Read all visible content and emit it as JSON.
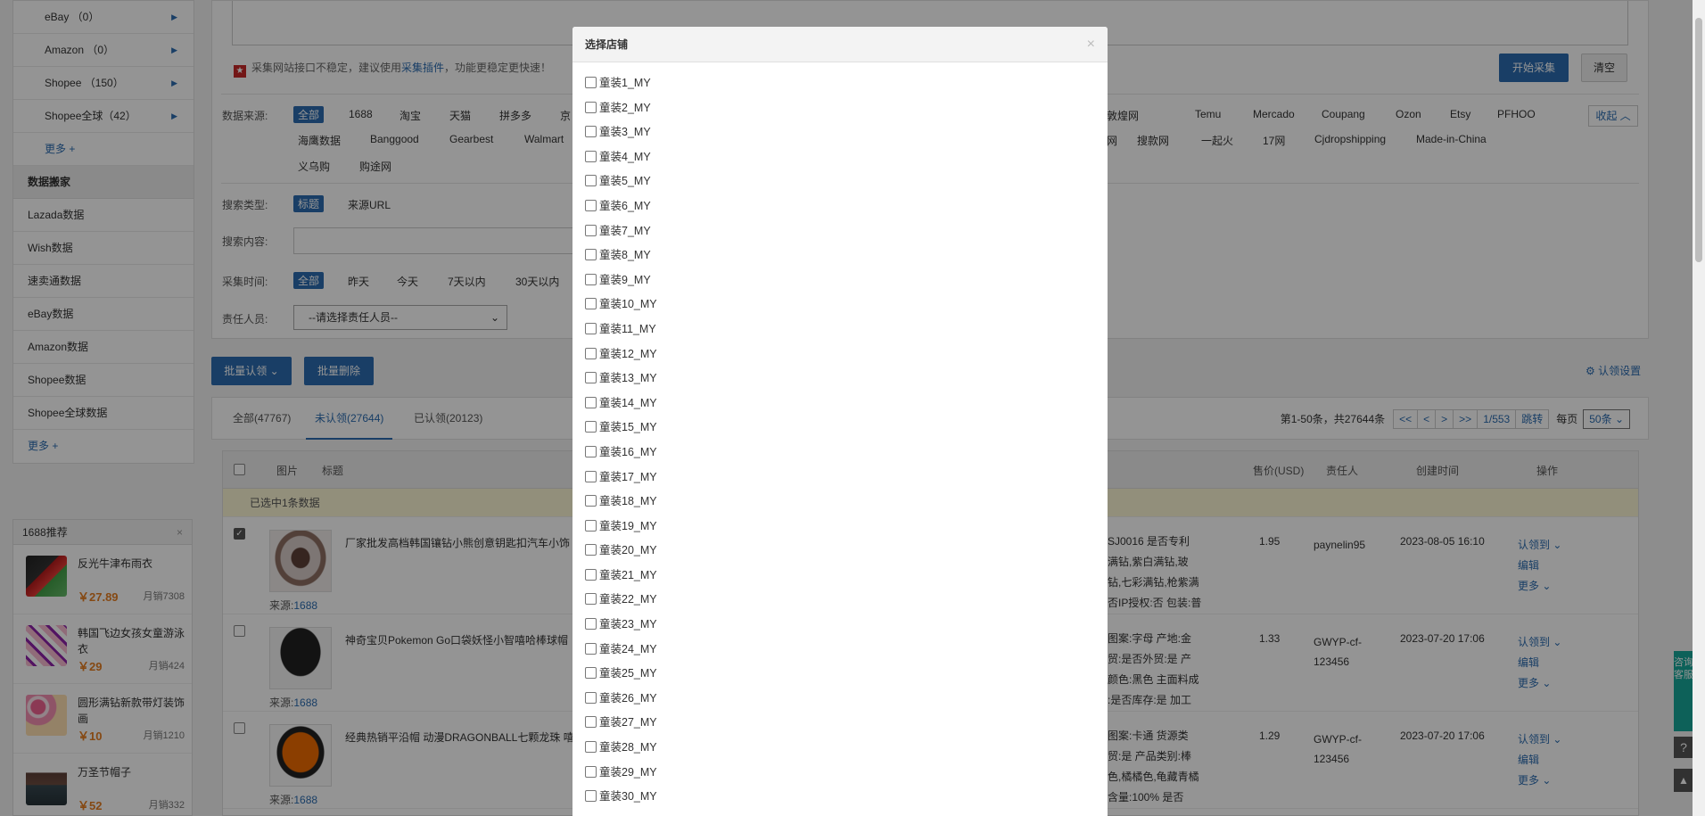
{
  "sidebar": {
    "platforms": [
      {
        "label": "eBay （0）"
      },
      {
        "label": "Amazon （0）"
      },
      {
        "label": "Shopee （150）"
      },
      {
        "label": "Shopee全球（42）"
      }
    ],
    "more1": "更多 +",
    "section_title": "数据搬家",
    "links": [
      "Lazada数据",
      "Wish数据",
      "速卖通数据",
      "eBay数据",
      "Amazon数据",
      "Shopee数据",
      "Shopee全球数据"
    ],
    "more2": "更多 +"
  },
  "recommend": {
    "title": "1688推荐",
    "close": "×",
    "items": [
      {
        "title": "反光牛津布雨衣",
        "price": "￥27.89",
        "sales": "月销7308"
      },
      {
        "title": "韩国飞边女孩女童游泳衣",
        "price": "￥29",
        "sales": "月销424"
      },
      {
        "title": "圆形满钻新款带灯装饰画",
        "price": "￥10",
        "sales": "月销1210"
      },
      {
        "title": "万圣节帽子",
        "price": "￥52",
        "sales": "月销332"
      }
    ]
  },
  "collect": {
    "warning_pre": "采集网站接口不稳定，建议使用",
    "warning_link": "采集插件",
    "warning_post": "，功能更稳定更快速！",
    "start_button": "开始采集",
    "clear_button": "清空"
  },
  "filters": {
    "source_label": "数据来源:",
    "source_all": "全部",
    "sources_row1_left": [
      "1688",
      "淘宝",
      "天猫",
      "拼多多",
      "京"
    ],
    "sources_row1_right": [
      "敦煌网",
      "Temu",
      "Mercado",
      "Coupang",
      "Ozon",
      "Etsy",
      "PFHOO"
    ],
    "sources_row2_left": [
      "海鹰数据",
      "Banggood",
      "Gearbest",
      "Walmart"
    ],
    "sources_row2_right": [
      "网",
      "搜款网",
      "一起火",
      "17网",
      "Cjdropshipping",
      "Made-in-China"
    ],
    "sources_row3": [
      "义乌购",
      "购途网"
    ],
    "collapse": "收起",
    "search_type_label": "搜索类型:",
    "search_type_active": "标题",
    "search_type_other": "来源URL",
    "search_content_label": "搜索内容:",
    "time_label": "采集时间:",
    "time_all": "全部",
    "time_options": [
      "昨天",
      "今天",
      "7天以内",
      "30天以内"
    ],
    "owner_label": "责任人员:",
    "owner_select": "--请选择责任人员--"
  },
  "actions": {
    "batch_claim": "批量认领",
    "batch_delete": "批量删除",
    "claim_settings": "认领设置"
  },
  "tabs": [
    {
      "label": "全部(47767)"
    },
    {
      "label": "未认领(27644)"
    },
    {
      "label": "已认领(20123)"
    }
  ],
  "pager": {
    "info": "第1-50条，共27644条",
    "first": "<<",
    "prev": "<",
    "next": ">",
    "last": ">>",
    "page": "1/553",
    "jump": "跳转",
    "per_page_label": "每页",
    "per_page": "50条"
  },
  "table": {
    "headers": {
      "image": "图片",
      "title": "标题",
      "price": "售价(USD)",
      "owner": "责任人",
      "created": "创建时间",
      "ops": "操作"
    },
    "selected_info": "已选中1条数据",
    "rows": [
      {
        "title": "厂家批发高档韩国镶钻小熊创意钥匙扣汽车小饰",
        "source_label": "来源:",
        "source": "1688",
        "specs": [
          "SJ0016 是否专利",
          "满钻,紫白满钻,玻",
          "钻,七彩满钻,枪紫满",
          "否IP授权:否 包装:普"
        ],
        "price": "1.95",
        "owner": "paynelin95",
        "created": "2023-08-05 16:10",
        "ops": [
          "认领到",
          "编辑",
          "更多"
        ]
      },
      {
        "title": "神奇宝贝Pokemon Go口袋妖怪小智嘻哈棒球帽",
        "source_label": "来源:",
        "source": "1688",
        "specs": [
          "图案:字母 产地:金",
          "贸:是否外贸:是 产",
          "颜色:黑色 主面料成",
          ":是否库存:是 加工"
        ],
        "price": "1.33",
        "owner": "GWYP-cf-123456",
        "created": "2023-07-20 17:06",
        "ops": [
          "认领到",
          "编辑",
          "更多"
        ]
      },
      {
        "title": "经典热销平沿帽 动漫DRAGONBALL七颗龙珠 嘻",
        "source_label": "来源:",
        "source": "1688",
        "specs": [
          "图案:卡通 货源类",
          "贸:是 产品类别:棒",
          "色,橘橘色,龟藏青橘",
          "含量:100% 是否"
        ],
        "price": "1.29",
        "owner": "GWYP-cf-123456",
        "created": "2023-07-20 17:06",
        "ops": [
          "认领到",
          "编辑",
          "更多"
        ]
      }
    ]
  },
  "modal": {
    "title": "选择店铺",
    "close": "×",
    "shops": [
      "童装1_MY",
      "童装2_MY",
      "童装3_MY",
      "童装4_MY",
      "童装5_MY",
      "童装6_MY",
      "童装7_MY",
      "童装8_MY",
      "童装9_MY",
      "童装10_MY",
      "童装11_MY",
      "童装12_MY",
      "童装13_MY",
      "童装14_MY",
      "童装15_MY",
      "童装16_MY",
      "童装17_MY",
      "童装18_MY",
      "童装19_MY",
      "童装20_MY",
      "童装21_MY",
      "童装22_MY",
      "童装23_MY",
      "童装24_MY",
      "童装25_MY",
      "童装26_MY",
      "童装27_MY",
      "童装28_MY",
      "童装29_MY",
      "童装30_MY"
    ]
  },
  "rail": {
    "kf_text": "咨询客服",
    "help": "?",
    "totop": "▲"
  }
}
